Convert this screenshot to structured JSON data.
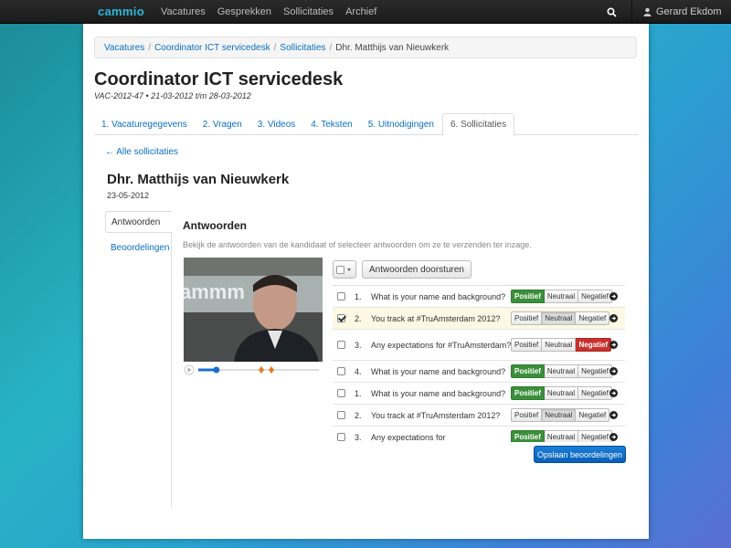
{
  "navbar": {
    "brand": "cammio",
    "links": [
      "Vacatures",
      "Gesprekken",
      "Sollicitaties",
      "Archief"
    ],
    "user_name": "Gerard Ekdom",
    "search_icon": "search-icon",
    "user_icon": "user-icon"
  },
  "breadcrumb": {
    "items": [
      "Vacatures",
      "Coordinator ICT servicedesk",
      "Sollicitaties"
    ],
    "current": "Dhr. Matthijs van Nieuwkerk"
  },
  "page": {
    "title": "Coordinator ICT servicedesk",
    "subtitle": "VAC-2012-47 • 21-03-2012 t/m 28-03-2012"
  },
  "tabs": [
    {
      "label": "1. Vacaturegegevens",
      "active": false
    },
    {
      "label": "2. Vragen",
      "active": false
    },
    {
      "label": "3. Videos",
      "active": false
    },
    {
      "label": "4. Teksten",
      "active": false
    },
    {
      "label": "5. Uitnodigingen",
      "active": false
    },
    {
      "label": "6. Sollicitaties",
      "active": true
    }
  ],
  "back_link": "← Alle sollicitaties",
  "candidate": {
    "name": "Dhr. Matthijs van Nieuwkerk",
    "date": "23-05-2012"
  },
  "side_tabs": [
    {
      "label": "Antwoorden",
      "active": true
    },
    {
      "label": "Beoordelingen",
      "active": false
    }
  ],
  "section": {
    "title": "Antwoorden",
    "description": "Bekijk de antwoorden van de kandidaat of selecteer antwoorden om ze te verzenden ter inzage."
  },
  "video": {
    "overlay_text": "ammm",
    "progress": 0.15,
    "buffered": 0.12
  },
  "toolbar": {
    "forward_label": "Antwoorden doorsturen"
  },
  "rating_labels": [
    "Positief",
    "Neutraal",
    "Negatief"
  ],
  "answers": [
    {
      "num": "1.",
      "question": "What is your name and background?",
      "checked": false,
      "rating": "Positief"
    },
    {
      "num": "2.",
      "question": "You track at #TruAmsterdam 2012?",
      "checked": true,
      "rating": "Neutraal"
    },
    {
      "num": "3.",
      "question": "Any expectations for #TruAmsterdam?",
      "checked": false,
      "rating": "Negatief"
    },
    {
      "num": "4.",
      "question": "What is your name and background?",
      "checked": false,
      "rating": "Positief"
    },
    {
      "num": "1.",
      "question": "What is your name and background?",
      "checked": false,
      "rating": "Positief"
    },
    {
      "num": "2.",
      "question": "You track at #TruAmsterdam 2012?",
      "checked": false,
      "rating": "Neutraal"
    },
    {
      "num": "3.",
      "question": "Any expectations for",
      "checked": false,
      "rating": "Positief"
    }
  ],
  "save_label": "Opslaan beoordelingen",
  "colors": {
    "accent": "#0a6fc0",
    "positive": "#3b8f3b",
    "negative": "#c9302c",
    "primary_button": "#0a5fb8"
  }
}
